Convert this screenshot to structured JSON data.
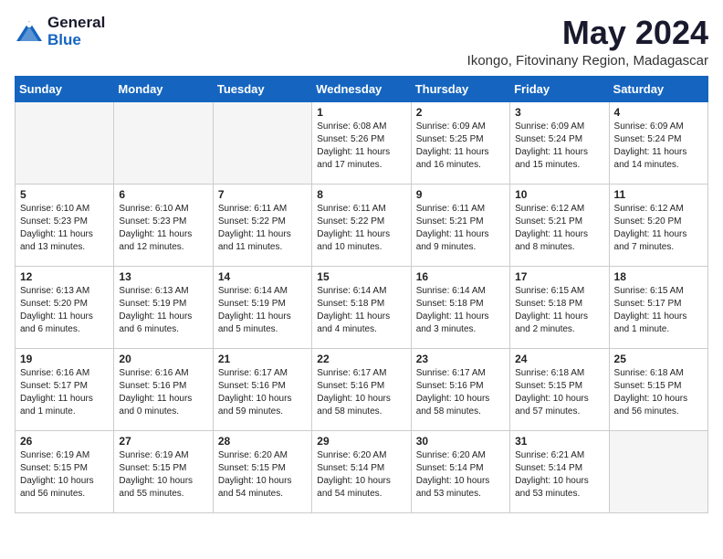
{
  "header": {
    "logo": {
      "general": "General",
      "blue": "Blue"
    },
    "month": "May 2024",
    "location": "Ikongo, Fitovinany Region, Madagascar"
  },
  "weekdays": [
    "Sunday",
    "Monday",
    "Tuesday",
    "Wednesday",
    "Thursday",
    "Friday",
    "Saturday"
  ],
  "weeks": [
    [
      {
        "day": "",
        "info": ""
      },
      {
        "day": "",
        "info": ""
      },
      {
        "day": "",
        "info": ""
      },
      {
        "day": "1",
        "info": "Sunrise: 6:08 AM\nSunset: 5:26 PM\nDaylight: 11 hours\nand 17 minutes."
      },
      {
        "day": "2",
        "info": "Sunrise: 6:09 AM\nSunset: 5:25 PM\nDaylight: 11 hours\nand 16 minutes."
      },
      {
        "day": "3",
        "info": "Sunrise: 6:09 AM\nSunset: 5:24 PM\nDaylight: 11 hours\nand 15 minutes."
      },
      {
        "day": "4",
        "info": "Sunrise: 6:09 AM\nSunset: 5:24 PM\nDaylight: 11 hours\nand 14 minutes."
      }
    ],
    [
      {
        "day": "5",
        "info": "Sunrise: 6:10 AM\nSunset: 5:23 PM\nDaylight: 11 hours\nand 13 minutes."
      },
      {
        "day": "6",
        "info": "Sunrise: 6:10 AM\nSunset: 5:23 PM\nDaylight: 11 hours\nand 12 minutes."
      },
      {
        "day": "7",
        "info": "Sunrise: 6:11 AM\nSunset: 5:22 PM\nDaylight: 11 hours\nand 11 minutes."
      },
      {
        "day": "8",
        "info": "Sunrise: 6:11 AM\nSunset: 5:22 PM\nDaylight: 11 hours\nand 10 minutes."
      },
      {
        "day": "9",
        "info": "Sunrise: 6:11 AM\nSunset: 5:21 PM\nDaylight: 11 hours\nand 9 minutes."
      },
      {
        "day": "10",
        "info": "Sunrise: 6:12 AM\nSunset: 5:21 PM\nDaylight: 11 hours\nand 8 minutes."
      },
      {
        "day": "11",
        "info": "Sunrise: 6:12 AM\nSunset: 5:20 PM\nDaylight: 11 hours\nand 7 minutes."
      }
    ],
    [
      {
        "day": "12",
        "info": "Sunrise: 6:13 AM\nSunset: 5:20 PM\nDaylight: 11 hours\nand 6 minutes."
      },
      {
        "day": "13",
        "info": "Sunrise: 6:13 AM\nSunset: 5:19 PM\nDaylight: 11 hours\nand 6 minutes."
      },
      {
        "day": "14",
        "info": "Sunrise: 6:14 AM\nSunset: 5:19 PM\nDaylight: 11 hours\nand 5 minutes."
      },
      {
        "day": "15",
        "info": "Sunrise: 6:14 AM\nSunset: 5:18 PM\nDaylight: 11 hours\nand 4 minutes."
      },
      {
        "day": "16",
        "info": "Sunrise: 6:14 AM\nSunset: 5:18 PM\nDaylight: 11 hours\nand 3 minutes."
      },
      {
        "day": "17",
        "info": "Sunrise: 6:15 AM\nSunset: 5:18 PM\nDaylight: 11 hours\nand 2 minutes."
      },
      {
        "day": "18",
        "info": "Sunrise: 6:15 AM\nSunset: 5:17 PM\nDaylight: 11 hours\nand 1 minute."
      }
    ],
    [
      {
        "day": "19",
        "info": "Sunrise: 6:16 AM\nSunset: 5:17 PM\nDaylight: 11 hours\nand 1 minute."
      },
      {
        "day": "20",
        "info": "Sunrise: 6:16 AM\nSunset: 5:16 PM\nDaylight: 11 hours\nand 0 minutes."
      },
      {
        "day": "21",
        "info": "Sunrise: 6:17 AM\nSunset: 5:16 PM\nDaylight: 10 hours\nand 59 minutes."
      },
      {
        "day": "22",
        "info": "Sunrise: 6:17 AM\nSunset: 5:16 PM\nDaylight: 10 hours\nand 58 minutes."
      },
      {
        "day": "23",
        "info": "Sunrise: 6:17 AM\nSunset: 5:16 PM\nDaylight: 10 hours\nand 58 minutes."
      },
      {
        "day": "24",
        "info": "Sunrise: 6:18 AM\nSunset: 5:15 PM\nDaylight: 10 hours\nand 57 minutes."
      },
      {
        "day": "25",
        "info": "Sunrise: 6:18 AM\nSunset: 5:15 PM\nDaylight: 10 hours\nand 56 minutes."
      }
    ],
    [
      {
        "day": "26",
        "info": "Sunrise: 6:19 AM\nSunset: 5:15 PM\nDaylight: 10 hours\nand 56 minutes."
      },
      {
        "day": "27",
        "info": "Sunrise: 6:19 AM\nSunset: 5:15 PM\nDaylight: 10 hours\nand 55 minutes."
      },
      {
        "day": "28",
        "info": "Sunrise: 6:20 AM\nSunset: 5:15 PM\nDaylight: 10 hours\nand 54 minutes."
      },
      {
        "day": "29",
        "info": "Sunrise: 6:20 AM\nSunset: 5:14 PM\nDaylight: 10 hours\nand 54 minutes."
      },
      {
        "day": "30",
        "info": "Sunrise: 6:20 AM\nSunset: 5:14 PM\nDaylight: 10 hours\nand 53 minutes."
      },
      {
        "day": "31",
        "info": "Sunrise: 6:21 AM\nSunset: 5:14 PM\nDaylight: 10 hours\nand 53 minutes."
      },
      {
        "day": "",
        "info": ""
      }
    ]
  ]
}
